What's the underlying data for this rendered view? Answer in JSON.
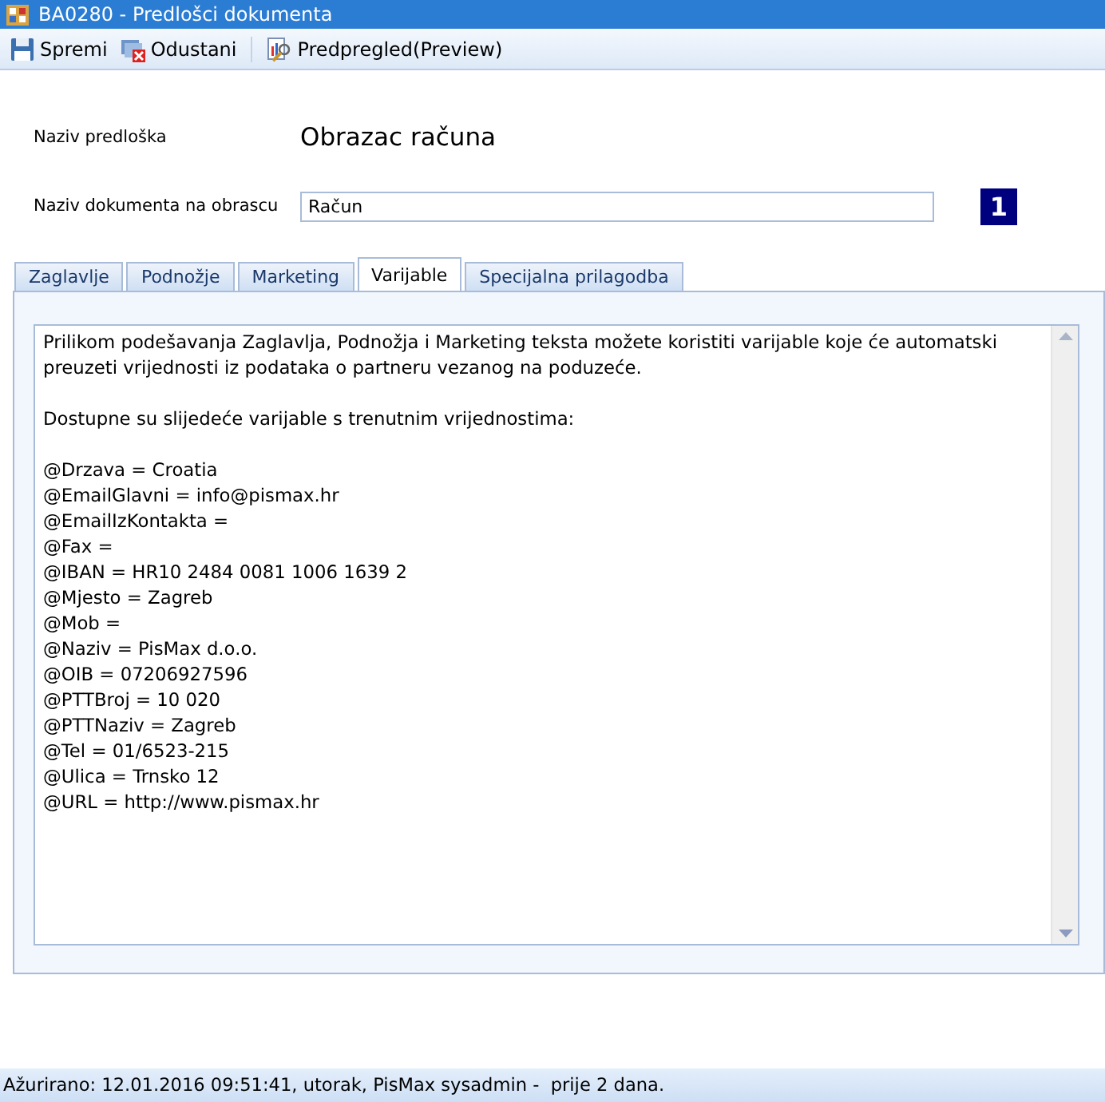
{
  "window": {
    "title": "BA0280 - Predlošci dokumenta"
  },
  "toolbar": [
    {
      "label": "Spremi",
      "kind": "save"
    },
    {
      "label": "Odustani",
      "kind": "cancel"
    },
    {
      "label": "Predpregled(Preview)",
      "kind": "preview",
      "separator_before": true
    }
  ],
  "form": {
    "template_label": "Naziv predloška",
    "template_name": "Obrazac računa",
    "document_label": "Naziv dokumenta na obrascu",
    "document_value": "Račun",
    "badge": "1"
  },
  "tabs": [
    {
      "label": "Zaglavlje",
      "selected": false
    },
    {
      "label": "Podnožje",
      "selected": false
    },
    {
      "label": "Marketing",
      "selected": false
    },
    {
      "label": "Varijable",
      "selected": true
    },
    {
      "label": "Specijalna prilagodba",
      "selected": false
    }
  ],
  "content": {
    "paragraphs": [
      {
        "lines": [
          "Prilikom podešavanja Zaglavlja, Podnožja i Marketing teksta možete koristiti varijable koje će automatski",
          "preuzeti vrijednosti iz podataka o partneru vezanog na poduzeće."
        ]
      },
      {
        "lines": [
          "Dostupne su slijedeće varijable s trenutnim vrijednostima:"
        ]
      },
      {
        "lines": [
          "@Drzava = Croatia",
          "@EmailGlavni = info@pismax.hr",
          "@EmailIzKontakta =",
          "@Fax =",
          "@IBAN = HR10 2484 0081 1006 1639 2",
          "@Mjesto = Zagreb",
          "@Mob =",
          "@Naziv = PisMax d.o.o.",
          "@OIB = 07206927596",
          "@PTTBroj = 10 020",
          "@PTTNaziv = Zagreb",
          "@Tel = 01/6523-215",
          "@Ulica = Trnsko 12",
          "@URL = http://www.pismax.hr"
        ]
      }
    ]
  },
  "status_bar": "Ažurirano: 12.01.2016 09:51:41, utorak, PisMax sysadmin -  prije 2 dana."
}
